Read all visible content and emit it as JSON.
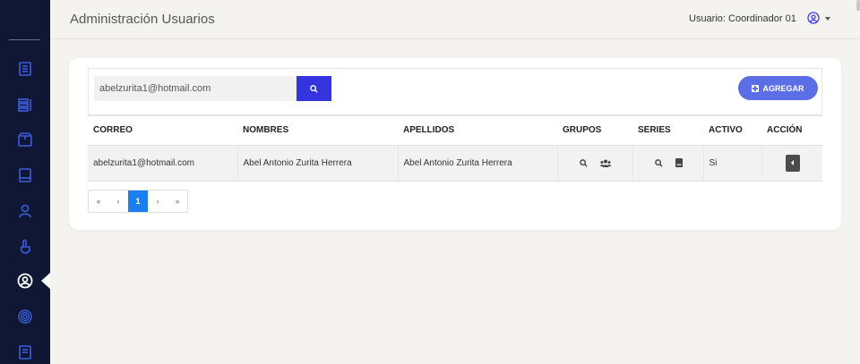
{
  "header": {
    "title": "Administración Usuarios",
    "user_label": "Usuario: Coordinador 01"
  },
  "sidebar": {
    "items": [
      {
        "icon": "document-list-icon"
      },
      {
        "icon": "list-icon"
      },
      {
        "icon": "package-icon"
      },
      {
        "icon": "book-icon"
      },
      {
        "icon": "user-icon"
      },
      {
        "icon": "hand-pointer-icon"
      },
      {
        "icon": "user-circle-icon",
        "active": true
      },
      {
        "icon": "fingerprint-icon"
      },
      {
        "icon": "notebook-icon"
      }
    ]
  },
  "search": {
    "value": "abelzurita1@hotmail.com"
  },
  "add_button": {
    "label": "AGREGAR"
  },
  "table": {
    "headers": [
      "CORREO",
      "NOMBRES",
      "APELLIDOS",
      "GRUPOS",
      "SERIES",
      "ACTIVO",
      "ACCIÓN"
    ],
    "rows": [
      {
        "correo": "abelzurita1@hotmail.com",
        "nombres": "Abel Antonio Zurita Herrera",
        "apellidos": "Abel Antonio Zurita Herrera",
        "activo": "Si"
      }
    ]
  },
  "pagination": {
    "first": "«",
    "prev": "‹",
    "current": "1",
    "next": "›",
    "last": "»"
  },
  "colors": {
    "sidebar": "#101735",
    "primary": "#3535e0",
    "add": "#5b6ee6",
    "page_active": "#1a7ff0"
  }
}
